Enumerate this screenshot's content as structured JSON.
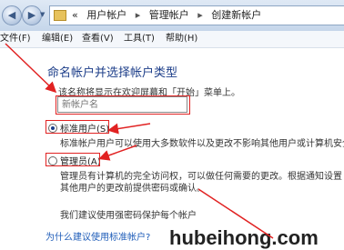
{
  "address_bar": {
    "back_glyph": "◀",
    "forward_glyph": "▶",
    "dropdown_glyph": "▼",
    "overflow": "«",
    "breadcrumbs": [
      "用户帐户",
      "管理帐户",
      "创建新帐户"
    ],
    "separator": "▸"
  },
  "menu": {
    "items": [
      "文件(F)",
      "编辑(E)",
      "查看(V)",
      "工具(T)",
      "帮助(H)"
    ]
  },
  "content": {
    "heading": "命名帐户并选择帐户类型",
    "hint": "该名称将显示在欢迎屏幕和「开始」菜单上。",
    "name_input_placeholder": "新帐户名",
    "option_standard": {
      "label": "标准用户(S)",
      "description": "标准帐户用户可以使用大多数软件以及更改不影响其他用户或计算机安全"
    },
    "option_admin": {
      "label": "管理员(A)",
      "description_line1": "管理员有计算机的完全访问权，可以做任何需要的更改。根据通知设置",
      "description_line2": "其他用户的更改前提供密码或确认。"
    },
    "recommendation": "我们建议使用强密码保护每个帐户",
    "help_link": "为什么建议使用标准帐户?",
    "watermark": "hubeihong.com"
  },
  "colors": {
    "annotation_red": "#e12222",
    "heading_blue": "#1e3f8a",
    "link_blue": "#1c5bb8"
  }
}
